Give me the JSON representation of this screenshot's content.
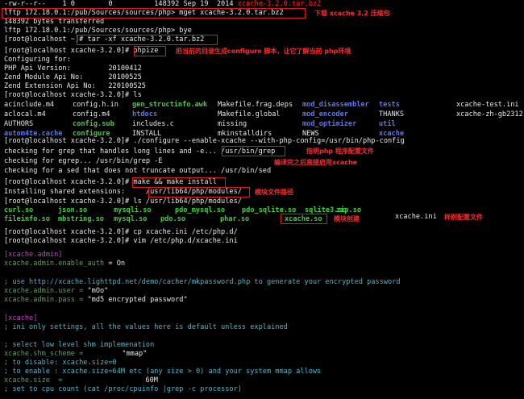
{
  "terminal": {
    "line1": "-rw-r--r--    1 0        0          148392 Sep 19  2014 ",
    "line1_file": "xcache-3.2.0.tar.bz2",
    "line2": "lftp 172.18.0.1:/pub/Sources/sources/php> mget xcache-3.2.0.tar.bz2",
    "line3": "148392 bytes transferred",
    "line4": "lftp 172.18.0.1:/pub/Sources/sources/php> bye",
    "line5": "[root@localhost ~]# tar -xf xcache-3.2.0.tar.bz2",
    "line6_prompt": "[root@localhost xcache-3.2.0]# ",
    "line6_cmd": "phpize",
    "line7": "Configuring for:",
    "line8": "PHP Api Version:         20100412",
    "line9": "Zend Module Api No:      20100525",
    "line10": "Zend Extension Api No:   220100525",
    "line11": "[root@localhost xcache-3.2.0]# ls",
    "ls1": [
      {
        "t": "acinclude.m4",
        "c": "w"
      },
      {
        "t": "config.h.in",
        "c": "w"
      },
      {
        "t": "gen_structinfo.awk",
        "c": "g"
      },
      {
        "t": "Makefile.frag.deps",
        "c": "w"
      },
      {
        "t": "mod_disassembler",
        "c": "b"
      },
      {
        "t": "tests",
        "c": "b"
      },
      {
        "t": "xcache-test.ini",
        "c": "w"
      }
    ],
    "ls2": [
      {
        "t": "aclocal.m4",
        "c": "w"
      },
      {
        "t": "config.m4",
        "c": "w"
      },
      {
        "t": "htdocs",
        "c": "b"
      },
      {
        "t": "Makefile.global",
        "c": "w"
      },
      {
        "t": "mod_encoder",
        "c": "b"
      },
      {
        "t": "THANKS",
        "c": "w"
      },
      {
        "t": "xcache-zh-gb2312",
        "c": "w"
      }
    ],
    "ls3": [
      {
        "t": "AUTHORS",
        "c": "w"
      },
      {
        "t": "config.sub",
        "c": "g"
      },
      {
        "t": "includes.c",
        "c": "w"
      },
      {
        "t": "missing",
        "c": "w"
      },
      {
        "t": "mod_optimizer",
        "c": "b"
      },
      {
        "t": "util",
        "c": "b"
      },
      {
        "t": "",
        "c": "w"
      }
    ],
    "ls4": [
      {
        "t": "autom4te.cache",
        "c": "b"
      },
      {
        "t": "configure",
        "c": "g"
      },
      {
        "t": "INSTALL",
        "c": "w"
      },
      {
        "t": "mkinstalldirs",
        "c": "w"
      },
      {
        "t": "NEWS",
        "c": "w"
      },
      {
        "t": "xcache",
        "c": "b"
      },
      {
        "t": "",
        "c": "w"
      }
    ],
    "line16": "[root@localhost xcache-3.2.0]# ./configure --enable-xcache --with-php-config=/usr/bin/php-config",
    "line17a": "checking for grep that handles long lines and -e... ",
    "line17b": "/usr/bin/grep",
    "line18a": "checking for egrep... /usr/bin/grep -E",
    "line19": "checking for a sed that does not truncate output... /usr/bin/sed",
    "line20_prompt": "[root@localhost xcache-3.2.0]# ",
    "line20_cmd": "make && make install",
    "line21a": "Installing shared extensions:     ",
    "line21b": "/usr/lib64/php/modules/",
    "line22": "[root@localhost xcache-3.2.0]# ls /usr/lib64/php/modules/",
    "mods1": [
      "curl.so",
      "json.so",
      "mysqli.so",
      "pdo_mysql.so",
      "pdo_sqlite.so",
      "sqlite3.so",
      "zip.so"
    ],
    "mods2": [
      "fileinfo.so",
      "mbstring.so",
      "mysql.so",
      "pdo.so",
      "phar.so"
    ],
    "mods2_xcache": "xcache.so",
    "xcache_ini": "xcache.ini",
    "line25": "[root@localhost xcache-3.2.0]# cp xcache.ini /etc/php.d/",
    "line26": "[root@localhost xcache-3.2.0]# vim /etc/php.d/xcache.ini",
    "cfg_section1": "[xcache.admin]",
    "cfg_enable_auth_key": "xcache.admin.enable_auth",
    "cfg_enable_auth_val": " = On",
    "cfg_comment1": "; use http://xcache.lighttpd.net/demo/cacher/mkpassword.php to generate your encrypted password",
    "cfg_user_key": "xcache.admin.user = ",
    "cfg_user_val": "\"mOo\"",
    "cfg_pass_key": "xcache.admin.pass = ",
    "cfg_pass_val": "\"md5 encrypted password\"",
    "cfg_section2": "[xcache]",
    "cfg_comment2": "; ini only settings, all the values here is default unless explained",
    "cfg_comment3": "; select low level shm implemenation",
    "cfg_scheme_key": "xcache.shm_scheme =",
    "cfg_scheme_val": "\"mmap\"",
    "cfg_comment4": "; to disable: xcache.size=0",
    "cfg_comment5": "; to enable : xcache.size=64M etc (any size > 0) and your system mmap allows",
    "cfg_size_key": "xcache.size  =",
    "cfg_size_val": "60M",
    "cfg_comment6": "; set to cpu count (cat /proc/cpuinfo |grep -c processor)"
  },
  "annotations": {
    "download": "下载 xcache 3,2 压缩包",
    "phpize": "把当前的目录生成configure 脚本，让它了解当前 php环境",
    "phpconfig": "指明php 程序配置文件",
    "compile": "编译完之后直接启用xcache",
    "modpath": "模块文件路径",
    "module": "模块创建",
    "sample": "样例配置文件"
  },
  "colors": {
    "background": "#000000",
    "text": "#e8e8e8",
    "executable": "#3cd23c",
    "directory": "#5a74ff",
    "section": "#c048c0",
    "comment": "#4fb5c9",
    "key": "#6a9a6a",
    "annotation": "#ff2a2a"
  }
}
